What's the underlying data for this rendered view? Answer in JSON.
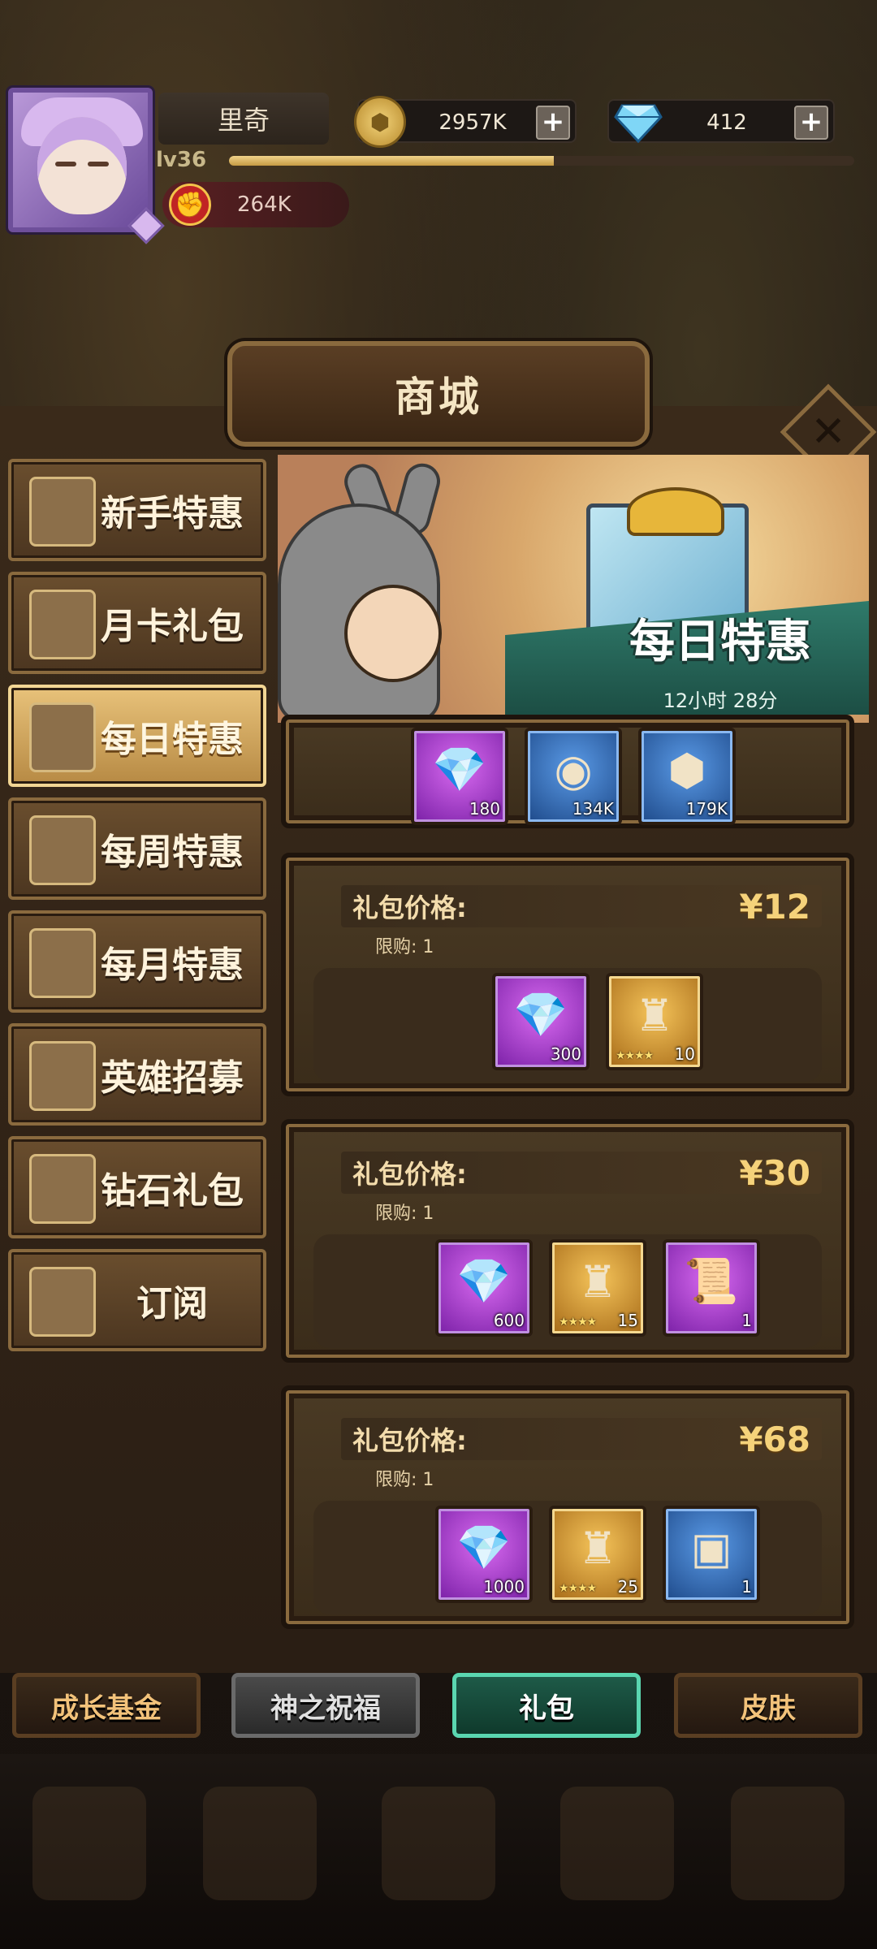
{
  "player": {
    "name": "里奇",
    "level": "lv36",
    "xp_fraction": 0.52,
    "power": "264K"
  },
  "resources": {
    "gold": "2957K",
    "gems": "412",
    "plus": "+"
  },
  "shop": {
    "title": "商城",
    "close_icon": "✕"
  },
  "sidebar": {
    "items": [
      {
        "label": "新手特惠",
        "icon": "sale-icon"
      },
      {
        "label": "月卡礼包",
        "icon": "card-icon"
      },
      {
        "label": "每日特惠",
        "icon": "gift-icon",
        "active": true
      },
      {
        "label": "每周特惠",
        "icon": "gift-icon"
      },
      {
        "label": "每月特惠",
        "icon": "gift-icon"
      },
      {
        "label": "英雄招募",
        "icon": "card-icon"
      },
      {
        "label": "钻石礼包",
        "icon": "ore-icon"
      },
      {
        "label": "订阅",
        "icon": "scroll-icon"
      }
    ]
  },
  "banner": {
    "title": "每日特惠",
    "timer": "12小时 28分"
  },
  "partial_pack": {
    "items": [
      {
        "type": "diamond",
        "count": "180",
        "rarity": "purple"
      },
      {
        "type": "exp-orb",
        "count": "134K",
        "rarity": "blue"
      },
      {
        "type": "gold-coin",
        "count": "179K",
        "rarity": "blue"
      }
    ]
  },
  "packs": [
    {
      "price_label": "礼包价格:",
      "price": "¥12",
      "limit": "限购: 1",
      "items": [
        {
          "type": "diamond",
          "count": "300",
          "rarity": "purple"
        },
        {
          "type": "hero-shard",
          "count": "10",
          "stars": "★★★★",
          "rarity": "gold"
        }
      ]
    },
    {
      "price_label": "礼包价格:",
      "price": "¥30",
      "limit": "限购: 1",
      "items": [
        {
          "type": "diamond",
          "count": "600",
          "rarity": "purple"
        },
        {
          "type": "hero-shard",
          "count": "15",
          "stars": "★★★★",
          "rarity": "gold"
        },
        {
          "type": "scroll",
          "count": "1",
          "rarity": "purple"
        }
      ]
    },
    {
      "price_label": "礼包价格:",
      "price": "¥68",
      "limit": "限购: 1",
      "items": [
        {
          "type": "diamond",
          "count": "1000",
          "rarity": "purple"
        },
        {
          "type": "hero-shard",
          "count": "25",
          "stars": "★★★★",
          "rarity": "gold"
        },
        {
          "type": "chest",
          "count": "1",
          "rarity": "blue"
        }
      ]
    }
  ],
  "tabs": [
    {
      "label": "成长基金"
    },
    {
      "label": "神之祝福"
    },
    {
      "label": "礼包",
      "active": true
    },
    {
      "label": "皮肤"
    }
  ],
  "colors": {
    "accent_gold": "#f5d27a",
    "active_tab": "#5ad6b0",
    "purple_rarity": "#a646d0",
    "gold_rarity": "#d89a2c",
    "blue_rarity": "#3a7ad0"
  }
}
